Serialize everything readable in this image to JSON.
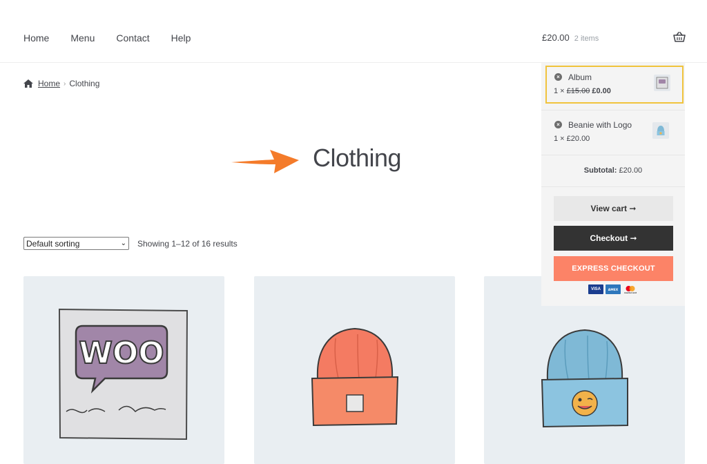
{
  "nav": {
    "items": [
      "Home",
      "Menu",
      "Contact",
      "Help"
    ]
  },
  "header_cart": {
    "total": "£20.00",
    "count": "2 items",
    "icon": "basket-icon"
  },
  "breadcrumb": {
    "home": "Home",
    "current": "Clothing"
  },
  "page": {
    "title": "Clothing"
  },
  "sort": {
    "selected": "Default sorting",
    "result_count": "Showing 1–12 of 16 results"
  },
  "products": [
    {
      "image": "woo-album-image"
    },
    {
      "image": "orange-beanie-image"
    },
    {
      "image": "blue-beanie-logo-image"
    }
  ],
  "mini_cart": {
    "items": [
      {
        "name": "Album",
        "qty": "1 ×",
        "old_price": "£15.00",
        "price": "£0.00"
      },
      {
        "name": "Beanie with Logo",
        "qty": "1 × £20.00"
      }
    ],
    "subtotal_label": "Subtotal:",
    "subtotal_value": "£20.00",
    "view_cart": "View cart",
    "checkout": "Checkout",
    "express": "EXPRESS CHECKOUT",
    "cards": [
      "VISA",
      "AMEX",
      "mastercard"
    ]
  },
  "colors": {
    "highlight_border": "#f0c33c",
    "express_button": "#fc8367",
    "checkout_button": "#333333",
    "arrow": "#f47b2a",
    "product_bg": "#e9eef2"
  }
}
